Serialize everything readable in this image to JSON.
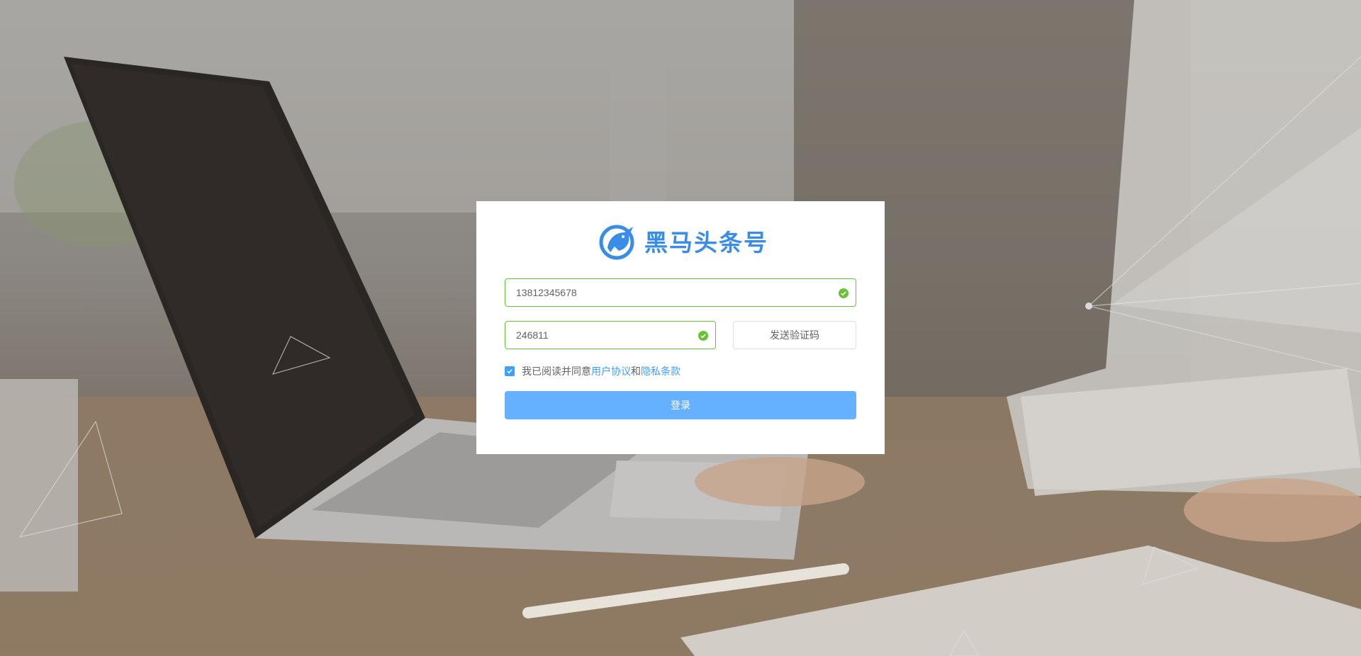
{
  "brand": {
    "name": "黑马头条号",
    "logo_icon": "horse-head-logo",
    "color": "#3a8de6"
  },
  "form": {
    "phone": {
      "value": "13812345678",
      "status": "valid"
    },
    "code": {
      "value": "246811",
      "status": "valid"
    },
    "send_code_label": "发送验证码",
    "agreement": {
      "checked": true,
      "prefix": "我已阅读并同意",
      "user_agreement_label": "用户协议",
      "conjunction": "和",
      "privacy_label": "隐私条款"
    },
    "login_label": "登录"
  },
  "colors": {
    "valid": "#67c23a",
    "primary": "#409eff",
    "login_button": "#66b1ff"
  }
}
